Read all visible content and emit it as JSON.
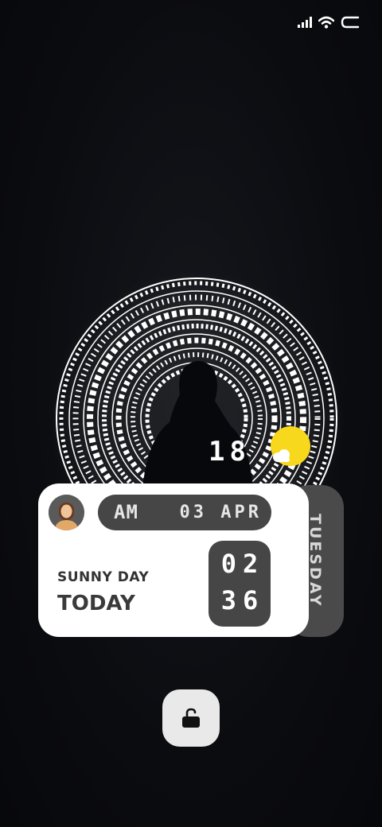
{
  "status_bar": {
    "icons": [
      "signal-icon",
      "wifi-icon",
      "battery-icon"
    ]
  },
  "weather": {
    "temperature": "18",
    "icon": "sun-cloud-icon",
    "description": "SUNNY DAY",
    "day_label": "TODAY"
  },
  "clock": {
    "ampm": "AM",
    "date": "03 APR",
    "hours": "02",
    "minutes": "36",
    "weekday": "TUESDAY"
  },
  "lock": {
    "icon": "unlock-icon"
  },
  "colors": {
    "background": "#0b0c10",
    "card": "#ffffff",
    "dark_pill": "#464646",
    "accent_sun": "#f8d81c"
  }
}
